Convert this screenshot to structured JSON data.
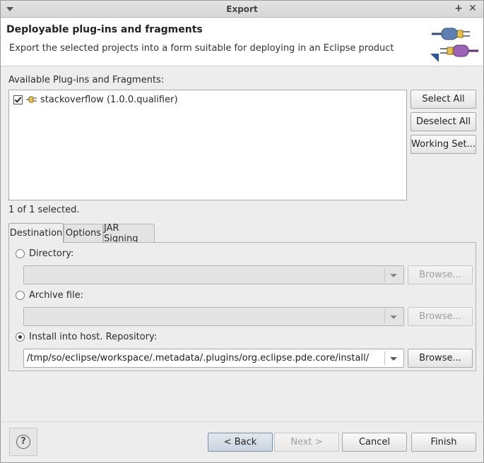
{
  "window": {
    "title": "Export"
  },
  "header": {
    "title": "Deployable plug-ins and fragments",
    "description": "Export the selected projects into a form suitable for deploying in an Eclipse product"
  },
  "available": {
    "label": "Available Plug-ins and Fragments:",
    "items": [
      {
        "label": "stackoverflow (1.0.0.qualifier)",
        "checked": true
      }
    ],
    "selection_status": "1 of 1 selected."
  },
  "side_buttons": {
    "select_all": "Select All",
    "deselect_all": "Deselect All",
    "working_set": "Working Set..."
  },
  "tabs": [
    {
      "label": "Destination",
      "active": true
    },
    {
      "label": "Options",
      "active": false
    },
    {
      "label": "JAR Signing",
      "active": false
    }
  ],
  "destination": {
    "directory": {
      "label": "Directory:",
      "selected": false,
      "value": "",
      "browse": "Browse..."
    },
    "archive": {
      "label": "Archive file:",
      "selected": false,
      "value": "",
      "browse": "Browse..."
    },
    "install": {
      "label": "Install into host. Repository:",
      "selected": true,
      "value": "/tmp/so/eclipse/workspace/.metadata/.plugins/org.eclipse.pde.core/install/",
      "browse": "Browse..."
    }
  },
  "footer": {
    "help_icon": "question-mark-icon",
    "back": "< Back",
    "next": "Next >",
    "cancel": "Cancel",
    "finish": "Finish"
  }
}
